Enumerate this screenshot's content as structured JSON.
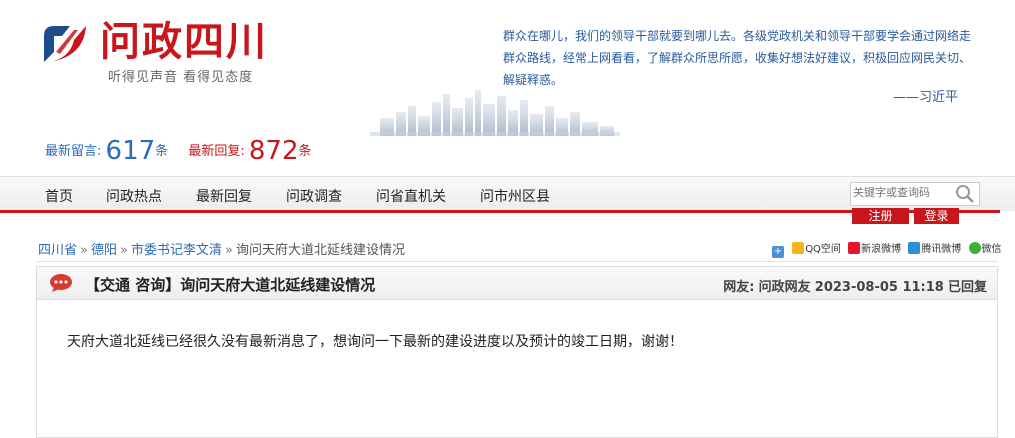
{
  "header": {
    "logo_title": "问政四川",
    "logo_slogan": "听得见声音 看得见态度",
    "quote": "群众在哪儿，我们的领导干部就要到哪儿去。各级党政机关和领导干部要学会通过网络走群众路线，经常上网看看，了解群众所思所愿，收集好想法好建议，积极回应网民关切、解疑释惑。",
    "quote_author": "——习近平"
  },
  "stats": {
    "latest_msg_label": "最新留言:",
    "latest_msg_count": "617",
    "latest_reply_label": "最新回复:",
    "latest_reply_count": "872",
    "unit": "条"
  },
  "nav": {
    "items": [
      "首页",
      "问政热点",
      "最新回复",
      "问政调查",
      "问省直机关",
      "问市州区县"
    ]
  },
  "search": {
    "placeholder": "关键字或查询码",
    "icon": "search-icon"
  },
  "auth": {
    "register": "注册",
    "login": "登录"
  },
  "breadcrumb": [
    "四川省",
    "德阳",
    "市委书记李文清",
    "询问天府大道北延线建设情况"
  ],
  "breadcrumb_sep": "»",
  "share": [
    "QQ空间",
    "新浪微博",
    "腾讯微博",
    "微信"
  ],
  "post": {
    "title": "【交通 咨询】询问天府大道北延线建设情况",
    "meta_label": "网友:",
    "author": "问政网友",
    "date": "2023-08-05 11:18",
    "status": "已回复",
    "body": "天府大道北延线已经很久没有最新消息了，想询问一下最新的建设进度以及预计的竣工日期，谢谢！"
  },
  "colors": {
    "brand_red": "#c8161d",
    "link_blue": "#2b6cb8"
  }
}
